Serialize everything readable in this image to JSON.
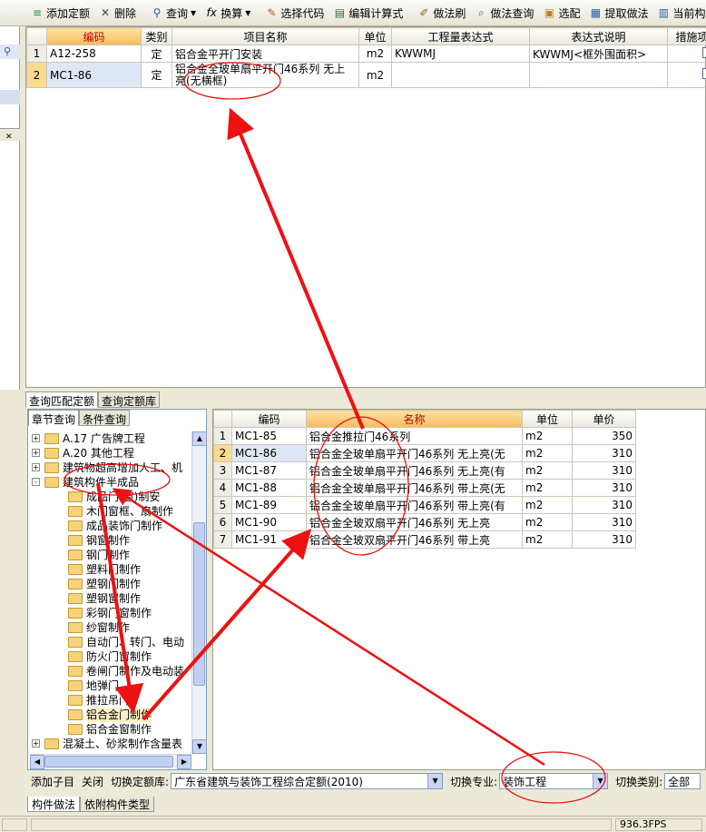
{
  "toolbar": {
    "add_quota": "添加定额",
    "delete": "删除",
    "query": "查询",
    "convert": "换算",
    "select_code": "选择代码",
    "edit_formula": "编辑计算式",
    "method_brush": "做法刷",
    "method_query": "做法查询",
    "select_match": "选配",
    "extract_method": "提取做法",
    "current": "当前构"
  },
  "top_grid": {
    "headers": [
      "编码",
      "类别",
      "项目名称",
      "单位",
      "工程量表达式",
      "表达式说明",
      "措施项"
    ],
    "rows": [
      {
        "num": "1",
        "code": "A12-258",
        "type": "定",
        "name": "铝合金平开门安装",
        "unit": "m2",
        "expr": "KWWMJ",
        "expr_desc": "KWWMJ<框外围面积>"
      },
      {
        "num": "2",
        "code": "MC1-86",
        "type": "定",
        "name_line1": "铝合金全玻单扇平开门46系列 无上",
        "name_line2": "亮(无横框)",
        "unit": "m2",
        "expr": "",
        "expr_desc": ""
      }
    ]
  },
  "bottom_tabs": [
    "查询匹配定额",
    "查询定额库"
  ],
  "tree_tabs": [
    "章节查询",
    "条件查询"
  ],
  "tree": [
    {
      "pm": "+",
      "folder": true,
      "label": "A.17 广告牌工程",
      "level": 0
    },
    {
      "pm": "+",
      "folder": true,
      "label": "A.20 其他工程",
      "level": 0
    },
    {
      "pm": "+",
      "folder": true,
      "label": "建筑物超高增加人工、机",
      "level": 0
    },
    {
      "pm": "-",
      "folder": true,
      "label": "建筑构件半成品",
      "level": 0
    },
    {
      "folder": true,
      "label": "成品门(窗)制安",
      "level": 1
    },
    {
      "folder": true,
      "label": "木门窗框、扇制作",
      "level": 1
    },
    {
      "folder": true,
      "label": "成品装饰门制作",
      "level": 1
    },
    {
      "folder": true,
      "label": "钢窗制作",
      "level": 1
    },
    {
      "folder": true,
      "label": "钢门制作",
      "level": 1
    },
    {
      "folder": true,
      "label": "塑料门制作",
      "level": 1
    },
    {
      "folder": true,
      "label": "塑钢门制作",
      "level": 1
    },
    {
      "folder": true,
      "label": "塑钢窗制作",
      "level": 1
    },
    {
      "folder": true,
      "label": "彩钢门窗制作",
      "level": 1
    },
    {
      "folder": true,
      "label": "纱窗制作",
      "level": 1
    },
    {
      "folder": true,
      "label": "自动门、转门、电动",
      "level": 1
    },
    {
      "folder": true,
      "label": "防火门窗制作",
      "level": 1
    },
    {
      "folder": true,
      "label": "卷闸门制作及电动装",
      "level": 1
    },
    {
      "folder": true,
      "label": "地弹门",
      "level": 1
    },
    {
      "folder": true,
      "label": "推拉吊门",
      "level": 1
    },
    {
      "folder": true,
      "label": "铝合金门制作",
      "level": 1,
      "selected": true
    },
    {
      "folder": true,
      "label": "铝合金窗制作",
      "level": 1
    },
    {
      "pm": "+",
      "folder": true,
      "label": "混凝土、砂浆制作含量表",
      "level": 0
    }
  ],
  "right_grid": {
    "headers": [
      "编码",
      "名称",
      "单位",
      "单价"
    ],
    "rows": [
      {
        "num": "1",
        "code": "MC1-85",
        "name": "铝合金推拉门46系列",
        "unit": "m2",
        "price": "350"
      },
      {
        "num": "2",
        "code": "MC1-86",
        "name": "铝合金全玻单扇平开门46系列 无上亮(无",
        "unit": "m2",
        "price": "310"
      },
      {
        "num": "3",
        "code": "MC1-87",
        "name": "铝合金全玻单扇平开门46系列 无上亮(有",
        "unit": "m2",
        "price": "310"
      },
      {
        "num": "4",
        "code": "MC1-88",
        "name": "铝合金全玻单扇平开门46系列 带上亮(无",
        "unit": "m2",
        "price": "310"
      },
      {
        "num": "5",
        "code": "MC1-89",
        "name": "铝合金全玻单扇平开门46系列 带上亮(有",
        "unit": "m2",
        "price": "310"
      },
      {
        "num": "6",
        "code": "MC1-90",
        "name": "铝合金全玻双扇平开门46系列 无上亮",
        "unit": "m2",
        "price": "310"
      },
      {
        "num": "7",
        "code": "MC1-91",
        "name": "铝合金全玻双扇平开门46系列 带上亮",
        "unit": "m2",
        "price": "310"
      }
    ]
  },
  "bottom_bar": {
    "add_child": "添加子目",
    "close": "关闭",
    "switch_lib_label": "切换定额库:",
    "lib_value": "广东省建筑与装饰工程综合定额(2010)",
    "switch_major_label": "切换专业:",
    "major_value": "装饰工程",
    "switch_type_label": "切换类别:",
    "type_value": "全部"
  },
  "bottom_tabs2": [
    "构件做法",
    "依附构件类型"
  ],
  "status": {
    "fps": "936.3FPS"
  },
  "colors": {
    "annotation": "#ee1111",
    "selected_header": "#f6bd5d",
    "current_row": "#fbd98f"
  }
}
